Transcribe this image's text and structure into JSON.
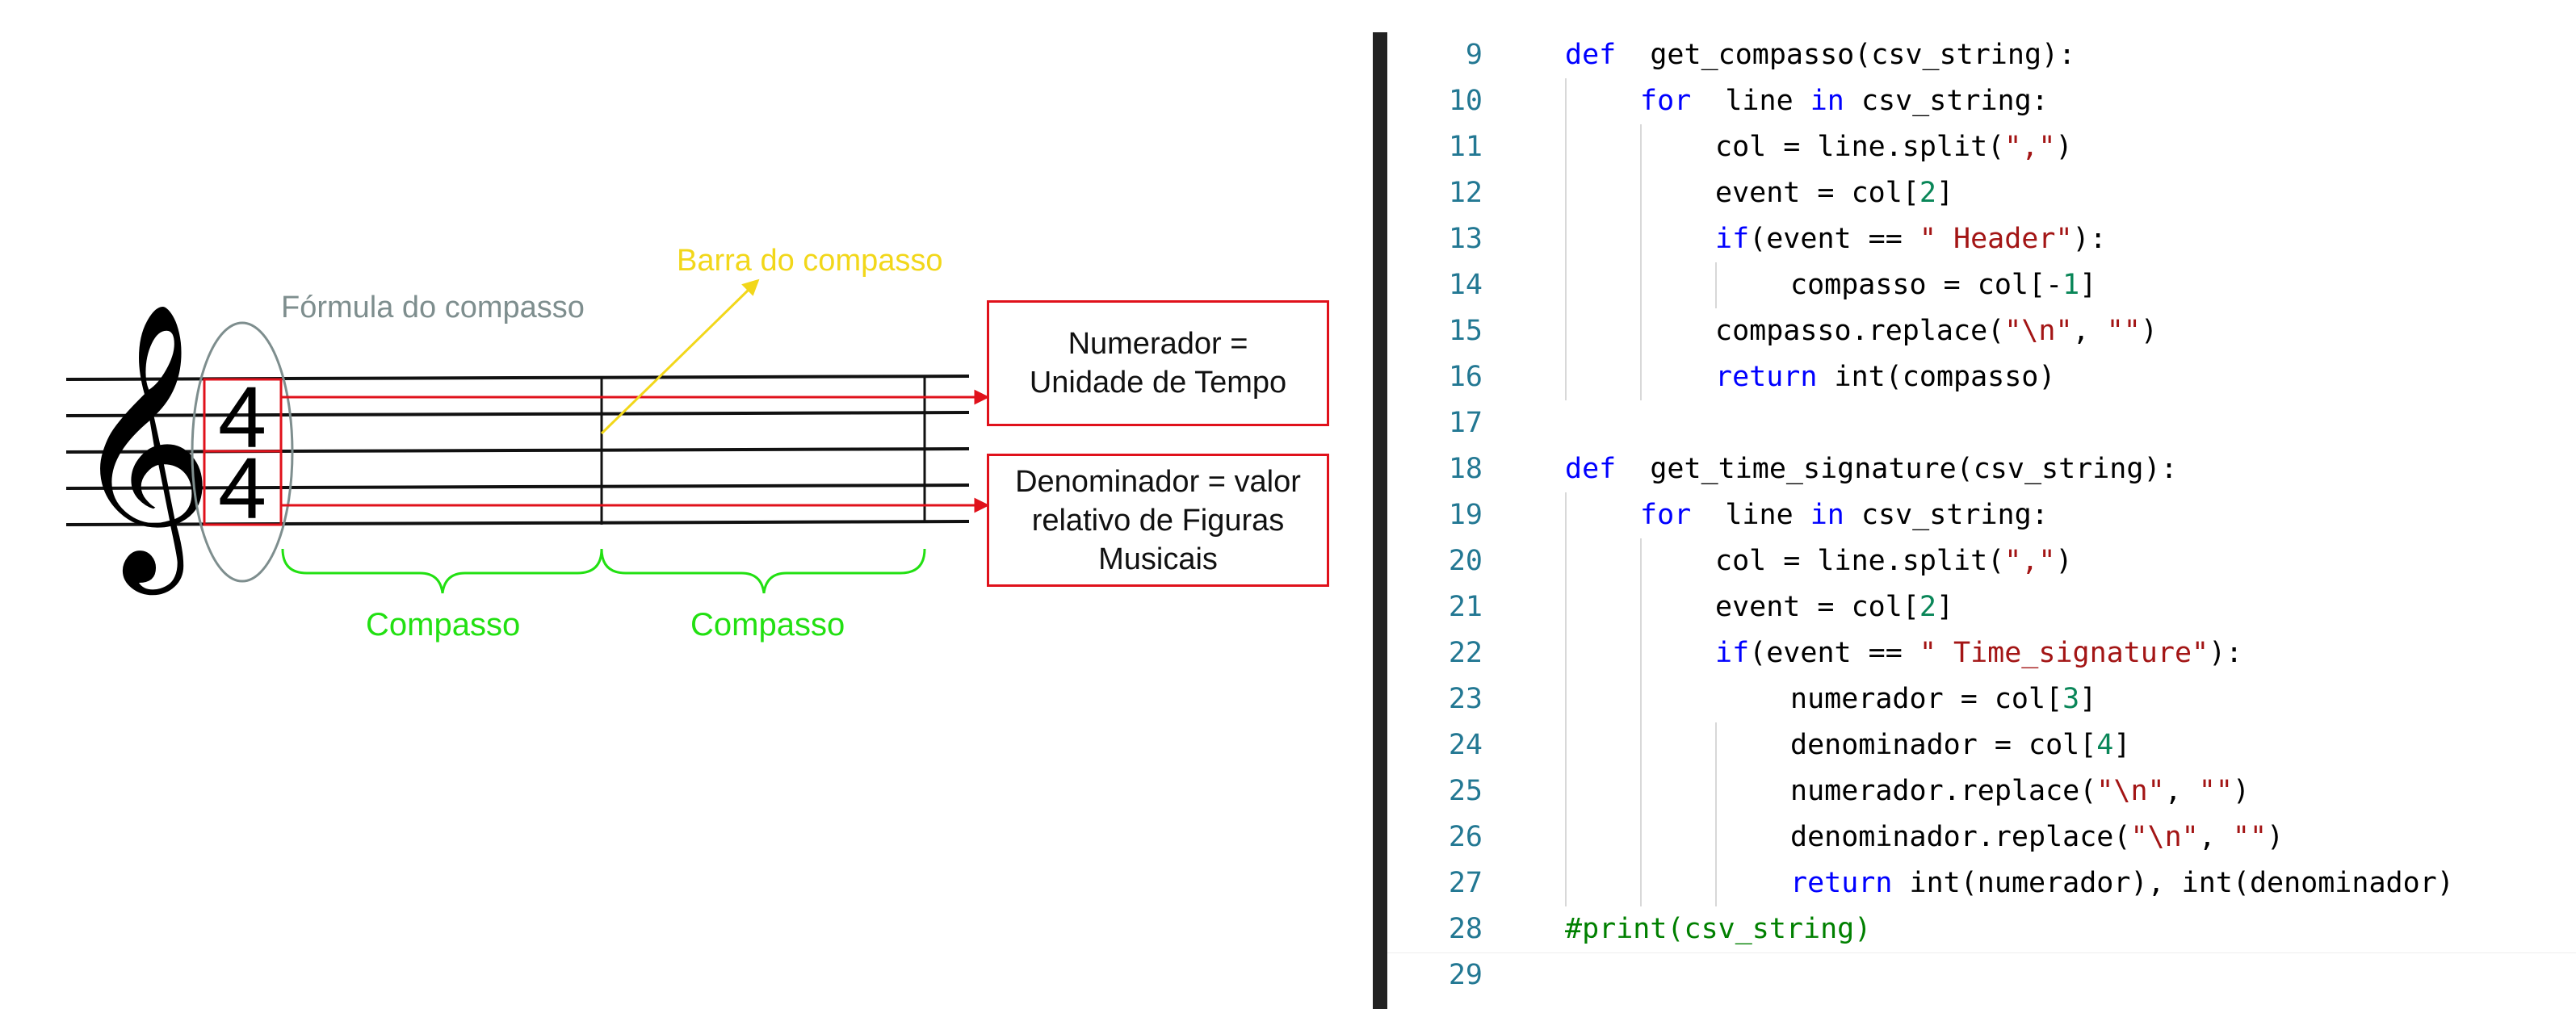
{
  "diagram": {
    "time_signature": {
      "numerator": "4",
      "denominator": "4"
    },
    "labels": {
      "formula": "Fórmula do compasso",
      "barline": "Barra do compasso",
      "measure_1": "Compasso",
      "measure_2": "Compasso"
    },
    "boxes": {
      "numerator": [
        "Numerador =",
        "Unidade de Tempo"
      ],
      "denominator": [
        "Denominador = valor",
        "relativo de Figuras",
        "Musicais"
      ]
    },
    "colors": {
      "staff": "#111111",
      "clef": "#000000",
      "formula_label": "#7e8e8e",
      "barline_label": "#f2d71a",
      "measure_label": "#22e012",
      "box_border": "#e0111b"
    }
  },
  "code": {
    "lines": [
      {
        "n": "9",
        "indent": 0,
        "tokens": [
          [
            "kw",
            "def"
          ],
          [
            "",
            "  get_compasso(csv_string):"
          ]
        ]
      },
      {
        "n": "10",
        "indent": 1,
        "tokens": [
          [
            "kw",
            "for"
          ],
          [
            "",
            "  line "
          ],
          [
            "kw",
            "in"
          ],
          [
            "",
            " csv_string:"
          ]
        ]
      },
      {
        "n": "11",
        "indent": 2,
        "tokens": [
          [
            "",
            "col = line.split("
          ],
          [
            "str",
            "\",\""
          ],
          [
            "",
            ")"
          ]
        ]
      },
      {
        "n": "12",
        "indent": 2,
        "tokens": [
          [
            "",
            "event = col["
          ],
          [
            "num",
            "2"
          ],
          [
            "",
            "]"
          ]
        ]
      },
      {
        "n": "13",
        "indent": 2,
        "tokens": [
          [
            "kw",
            "if"
          ],
          [
            "",
            "(event == "
          ],
          [
            "str",
            "\" Header\""
          ],
          [
            "",
            "):"
          ]
        ]
      },
      {
        "n": "14",
        "indent": 3,
        "tokens": [
          [
            "",
            "compasso = col[-"
          ],
          [
            "num",
            "1"
          ],
          [
            "",
            "]"
          ]
        ]
      },
      {
        "n": "15",
        "indent": 2,
        "tokens": [
          [
            "",
            "compasso.replace("
          ],
          [
            "str",
            "\"\\n\""
          ],
          [
            "",
            ", "
          ],
          [
            "str",
            "\"\""
          ],
          [
            "",
            ")"
          ]
        ]
      },
      {
        "n": "16",
        "indent": 2,
        "tokens": [
          [
            "kw",
            "return"
          ],
          [
            "",
            " int(compasso)"
          ]
        ]
      },
      {
        "n": "17",
        "indent": 0,
        "tokens": []
      },
      {
        "n": "18",
        "indent": 0,
        "tokens": [
          [
            "kw",
            "def"
          ],
          [
            "",
            "  get_time_signature(csv_string):"
          ]
        ]
      },
      {
        "n": "19",
        "indent": 1,
        "tokens": [
          [
            "kw",
            "for"
          ],
          [
            "",
            "  line "
          ],
          [
            "kw",
            "in"
          ],
          [
            "",
            " csv_string:"
          ]
        ]
      },
      {
        "n": "20",
        "indent": 2,
        "tokens": [
          [
            "",
            "col = line.split("
          ],
          [
            "str",
            "\",\""
          ],
          [
            "",
            ")"
          ]
        ]
      },
      {
        "n": "21",
        "indent": 2,
        "tokens": [
          [
            "",
            "event = col["
          ],
          [
            "num",
            "2"
          ],
          [
            "",
            "]"
          ]
        ]
      },
      {
        "n": "22",
        "indent": 2,
        "tokens": [
          [
            "kw",
            "if"
          ],
          [
            "",
            "(event == "
          ],
          [
            "str",
            "\" Time_signature\""
          ],
          [
            "",
            "):"
          ]
        ]
      },
      {
        "n": "23",
        "indent": 3,
        "tokens": [
          [
            "",
            "numerador = col["
          ],
          [
            "num",
            "3"
          ],
          [
            "",
            "]"
          ]
        ]
      },
      {
        "n": "24",
        "indent": 3,
        "tokens": [
          [
            "",
            "denominador = col["
          ],
          [
            "num",
            "4"
          ],
          [
            "",
            "]"
          ]
        ]
      },
      {
        "n": "25",
        "indent": 3,
        "tokens": [
          [
            "",
            "numerador.replace("
          ],
          [
            "str",
            "\"\\n\""
          ],
          [
            "",
            ", "
          ],
          [
            "str",
            "\"\""
          ],
          [
            "",
            ")"
          ]
        ]
      },
      {
        "n": "26",
        "indent": 3,
        "tokens": [
          [
            "",
            "denominador.replace("
          ],
          [
            "str",
            "\"\\n\""
          ],
          [
            "",
            ", "
          ],
          [
            "str",
            "\"\""
          ],
          [
            "",
            ")"
          ]
        ]
      },
      {
        "n": "27",
        "indent": 3,
        "tokens": [
          [
            "kw",
            "return"
          ],
          [
            "",
            " int(numerador), int(denominador)"
          ]
        ]
      },
      {
        "n": "28",
        "indent": 0,
        "tokens": [
          [
            "cmt",
            "#print(csv_string)"
          ]
        ]
      },
      {
        "n": "29",
        "indent": 0,
        "tokens": []
      }
    ],
    "colors": {
      "line_number": "#237893",
      "keyword": "#0000ff",
      "string": "#a31515",
      "number": "#098658",
      "comment": "#008000"
    }
  }
}
